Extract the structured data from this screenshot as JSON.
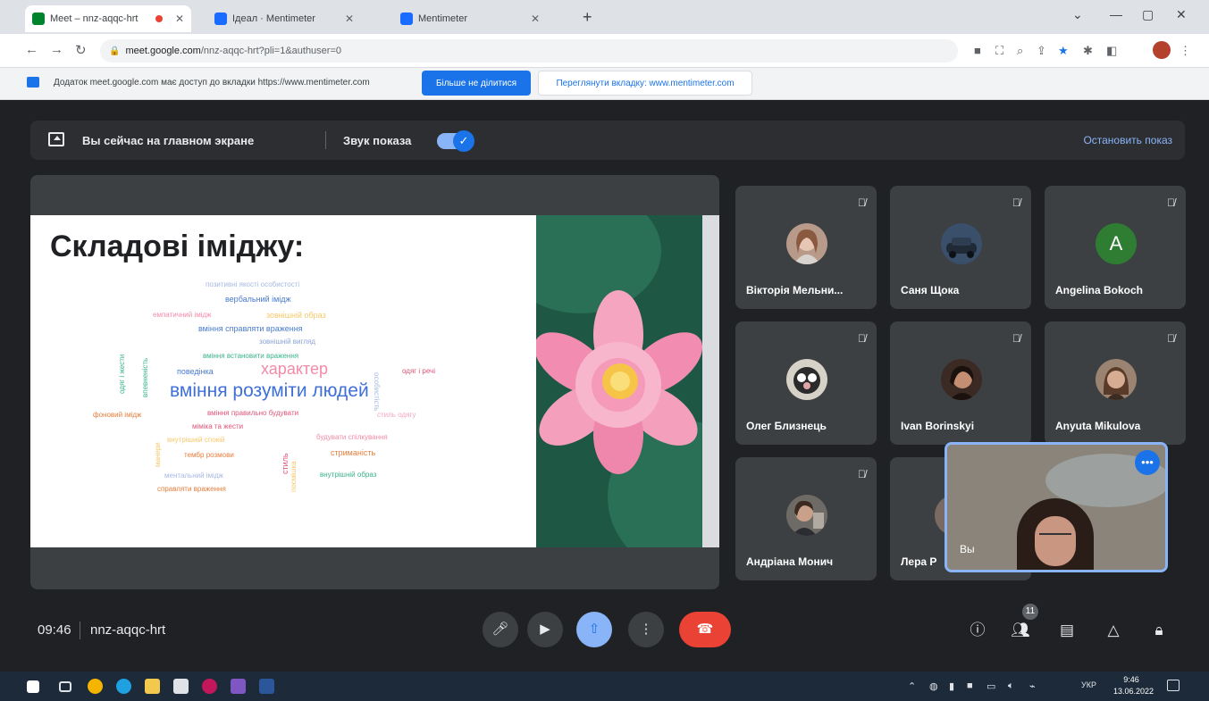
{
  "browser": {
    "tabs": [
      {
        "title": "Meet – nnz-aqqc-hrt",
        "active": true
      },
      {
        "title": "Ідеал · Mentimeter",
        "active": false
      },
      {
        "title": "Mentimeter",
        "active": false
      }
    ],
    "new_tab": "+",
    "address": {
      "host": "meet.google.com",
      "path": "/nnz-aqqc-hrt?pli=1&authuser=0"
    },
    "share_bar": {
      "message": "Додаток meet.google.com має доступ до вкладки https://www.mentimeter.com",
      "stop_button": "Більше не ділитися",
      "switch_button": "Переглянути вкладку: www.mentimeter.com"
    }
  },
  "meet": {
    "present_bar": {
      "status": "Вы сейчас на главном экране",
      "audio_label": "Звук показа",
      "stop_label": "Остановить показ"
    },
    "slide": {
      "title": "Складові іміджу:",
      "words": [
        {
          "text": "позитивні якості особистості",
          "color": "#a6b9e4"
        },
        {
          "text": "вербальний імідж",
          "color": "#4a7bd0"
        },
        {
          "text": "емпатичний імідж",
          "color": "#f28ba8"
        },
        {
          "text": "зовнішній образ",
          "color": "#f7c96b"
        },
        {
          "text": "вміння справляти враження",
          "color": "#4a7bd0"
        },
        {
          "text": "зовнішній вигляд",
          "color": "#8aa4d6"
        },
        {
          "text": "вміння встановити враження",
          "color": "#39b48a"
        },
        {
          "text": "поведінка",
          "color": "#4a7bd0"
        },
        {
          "text": "характер",
          "color": "#f28ba8"
        },
        {
          "text": "одяг і речі",
          "color": "#e0557a"
        },
        {
          "text": "вміння розуміти людей",
          "color": "#3f6fd8"
        },
        {
          "text": "фоновий імідж",
          "color": "#e67e3c"
        },
        {
          "text": "вміння правильно будувати",
          "color": "#e0557a"
        },
        {
          "text": "стиль одягу",
          "color": "#f2a7be"
        },
        {
          "text": "міміка та жести",
          "color": "#e0557a"
        },
        {
          "text": "будувати спілкування",
          "color": "#f28ba8"
        },
        {
          "text": "внутрішній спокій",
          "color": "#f7c96b"
        },
        {
          "text": "тембр розмови",
          "color": "#e67e3c"
        },
        {
          "text": "стриманість",
          "color": "#e67e3c"
        },
        {
          "text": "ментальний імідж",
          "color": "#a6b9e4"
        },
        {
          "text": "внутрішній образ",
          "color": "#39b48a"
        },
        {
          "text": "справляти враження",
          "color": "#e67e3c"
        },
        {
          "text": "одяг і жести",
          "color": "#39b48a"
        },
        {
          "text": "впевненість",
          "color": "#39b48a"
        },
        {
          "text": "особистість",
          "color": "#a6b9e4"
        },
        {
          "text": "стиль",
          "color": "#e0557a"
        },
        {
          "text": "манери",
          "color": "#f7c96b"
        },
        {
          "text": "посмішка",
          "color": "#f7c96b"
        }
      ]
    },
    "participants": [
      {
        "name": "Вікторія Мельни...",
        "avatar": "photo"
      },
      {
        "name": "Саня Щока",
        "avatar": "photo"
      },
      {
        "name": "Angelina Bokoch",
        "avatar": "letter",
        "letter": "A"
      },
      {
        "name": "Олег Близнець",
        "avatar": "photo"
      },
      {
        "name": "Ivan Borinskyi",
        "avatar": "photo"
      },
      {
        "name": "Anyuta Mikulova",
        "avatar": "photo"
      },
      {
        "name": "Андріана Монич",
        "avatar": "photo"
      },
      {
        "name": "Лера Р",
        "avatar": "photo"
      }
    ],
    "self_view": {
      "label": "Вы",
      "more": "•••"
    },
    "bottom": {
      "time": "09:46",
      "meeting_code": "nnz-aqqc-hrt",
      "people_count": "11"
    }
  },
  "taskbar": {
    "language": "УКР",
    "time": "9:46",
    "date": "13.06.2022"
  }
}
